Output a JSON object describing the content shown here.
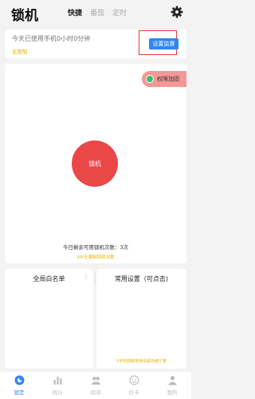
{
  "header": {
    "title": "锁机",
    "tabs": [
      {
        "label": "快捷",
        "active": true
      },
      {
        "label": "番茄",
        "active": false
      },
      {
        "label": "定时",
        "active": false
      }
    ],
    "settings_icon": "gear-icon"
  },
  "usage": {
    "text": "今天已使用手机0小时0分钟",
    "sub": "无限制",
    "supervise_button": "设置监督"
  },
  "lock": {
    "permission_label": "权限加固",
    "button_label": "锁机",
    "remaining_text": "今日剩余可用锁机次数：3次",
    "vip_note": "VIP无限制锁机次数"
  },
  "whitelist": {
    "title": "全局白名单",
    "menu_icon": "more-vertical-icon"
  },
  "common": {
    "title": "常用设置（可点击)",
    "vip_note": "VIP无限制常用设置存储个数"
  },
  "nav": [
    {
      "label": "锁定",
      "icon": "lock-icon",
      "active": true
    },
    {
      "label": "统计",
      "icon": "bar-chart-icon",
      "active": false
    },
    {
      "label": "房间",
      "icon": "people-icon",
      "active": false
    },
    {
      "label": "打卡",
      "icon": "smiley-icon",
      "active": false
    },
    {
      "label": "我的",
      "icon": "person-icon",
      "active": false
    }
  ],
  "colors": {
    "accent": "#2e86f2",
    "lock_button": "#ea4747",
    "vip": "#e4b400",
    "highlight_border": "#e5383b"
  }
}
